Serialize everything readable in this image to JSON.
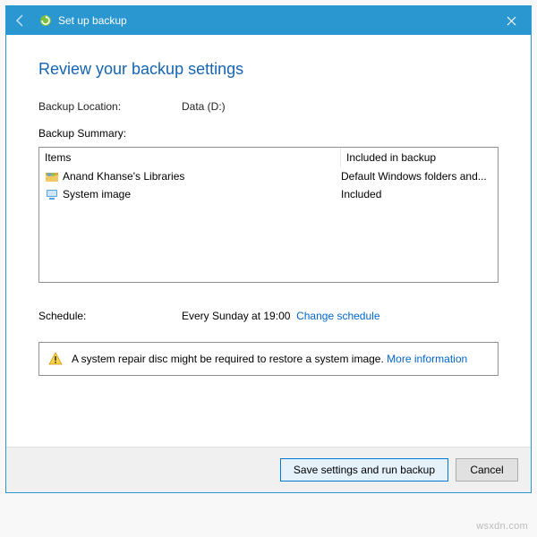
{
  "titlebar": {
    "title": "Set up backup"
  },
  "heading": "Review your backup settings",
  "location": {
    "label": "Backup Location:",
    "value": "Data (D:)"
  },
  "summary_label": "Backup Summary:",
  "table": {
    "head": {
      "items": "Items",
      "included": "Included in backup"
    },
    "rows": [
      {
        "icon": "libraries",
        "item": "Anand Khanse's Libraries",
        "included": "Default Windows folders and..."
      },
      {
        "icon": "system-image",
        "item": "System image",
        "included": "Included"
      }
    ]
  },
  "schedule": {
    "label": "Schedule:",
    "value": "Every Sunday at 19:00",
    "change_link": "Change schedule"
  },
  "warning": {
    "text": "A system repair disc might be required to restore a system image.",
    "link": "More information"
  },
  "buttons": {
    "save": "Save settings and run backup",
    "cancel": "Cancel"
  },
  "watermark": "wsxdn.com"
}
